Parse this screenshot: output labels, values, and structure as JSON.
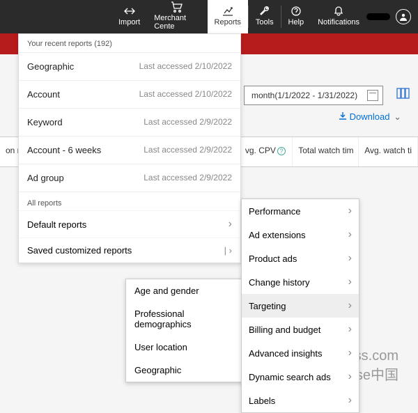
{
  "topbar": {
    "import": "Import",
    "merchant": "Merchant Cente",
    "reports": "Reports",
    "tools": "Tools",
    "help": "Help",
    "notifications": "Notifications"
  },
  "dropdown": {
    "recent_header": "Your recent reports (192)",
    "recent": [
      {
        "label": "Geographic",
        "accessed": "Last accessed 2/10/2022"
      },
      {
        "label": "Account",
        "accessed": "Last accessed 2/10/2022"
      },
      {
        "label": "Keyword",
        "accessed": "Last accessed 2/9/2022"
      },
      {
        "label": "Account - 6 weeks",
        "accessed": "Last accessed 2/9/2022"
      },
      {
        "label": "Ad group",
        "accessed": "Last accessed 2/9/2022"
      }
    ],
    "all_header": "All reports",
    "default_reports": "Default reports",
    "saved_reports": "Saved customized reports"
  },
  "submenu": {
    "items": [
      "Performance",
      "Ad extensions",
      "Product ads",
      "Change history",
      "Targeting",
      "Billing and budget",
      "Advanced insights",
      "Dynamic search ads",
      "Labels"
    ],
    "selected_index": 4
  },
  "submenu2": {
    "items": [
      "Age and gender",
      "Professional demographics",
      "User location",
      "Geographic"
    ]
  },
  "page": {
    "daterange": "month(1/1/2022 - 1/31/2022)",
    "download": "Download",
    "columns": {
      "c0": "on rat",
      "c1": "vg. CPV",
      "c2": "Total watch tim",
      "c3": "Avg. watch ti"
    }
  },
  "watermark1": "Adsenss.com",
  "watermark2": "adsense中国"
}
